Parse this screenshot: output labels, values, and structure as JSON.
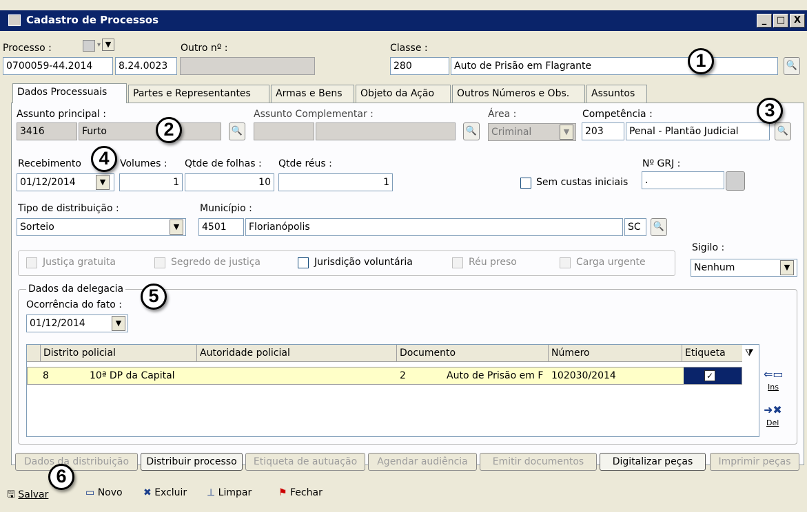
{
  "window": {
    "title": "Cadastro de Processos",
    "controls": [
      "_",
      "□",
      "X"
    ]
  },
  "header": {
    "processo_label": "Processo :",
    "processo_number": "0700059-44.2014",
    "processo_suffix": "8.24.0023",
    "outro_label": "Outro nº :",
    "outro_value": "",
    "classe_label": "Classe :",
    "classe_code": "280",
    "classe_name": "Auto de Prisão em Flagrante"
  },
  "tabs": [
    "Dados Processuais",
    "Partes e Representantes",
    "Armas e Bens",
    "Objeto da Ação",
    "Outros Números e Obs.",
    "Assuntos"
  ],
  "form": {
    "assunto_principal_label": "Assunto principal :",
    "assunto_code": "3416",
    "assunto_name": "Furto",
    "assunto_compl_label": "Assunto Complementar :",
    "area_label": "Área :",
    "area_value": "Criminal",
    "competencia_label": "Competência :",
    "competencia_code": "203",
    "competencia_name": "Penal - Plantão Judicial",
    "recebimento_label": "Recebimento",
    "recebimento_value": "01/12/2014",
    "volumes_label": "Volumes :",
    "volumes_value": "1",
    "folhas_label": "Qtde de folhas :",
    "folhas_value": "10",
    "reus_label": "Qtde réus :",
    "reus_value": "1",
    "grj_label": "Nº GRJ :",
    "grj_value": ".",
    "sem_custas_label": "Sem custas iniciais",
    "tipo_dist_label": "Tipo de distribuição :",
    "tipo_dist_value": "Sorteio",
    "municipio_label": "Município :",
    "municipio_code": "4501",
    "municipio_name": "Florianópolis",
    "uf": "SC",
    "sigilo_label": "Sigilo :",
    "sigilo_value": "Nenhum",
    "checks": [
      "Justiça gratuita",
      "Segredo de justiça",
      "Jurisdição voluntária",
      "Réu preso",
      "Carga urgente"
    ]
  },
  "delegacia": {
    "group_label": "Dados da delegacia",
    "ocorrencia_label": "Ocorrência do fato :",
    "ocorrencia_value": "01/12/2014",
    "columns": [
      "Distrito policial",
      "Autoridade policial",
      "Documento",
      "Número",
      "Etiqueta"
    ],
    "row": {
      "distrito_code": "8",
      "distrito_name": "10ª DP da Capital",
      "autoridade": "",
      "doc_code": "2",
      "doc_name": "Auto de Prisão em F",
      "numero": "102030/2014",
      "etiqueta": "✓"
    },
    "ins_label": "Ins",
    "del_label": "Del"
  },
  "actions": [
    "Dados da distribuição",
    "Distribuir processo",
    "Etiqueta de autuação",
    "Agendar audiência",
    "Emitir documentos",
    "Digitalizar peças",
    "Imprimir peças"
  ],
  "toolbar": [
    "Salvar",
    "Novo",
    "Excluir",
    "Limpar",
    "Fechar"
  ],
  "callouts": [
    "1",
    "2",
    "3",
    "4",
    "5",
    "6"
  ]
}
